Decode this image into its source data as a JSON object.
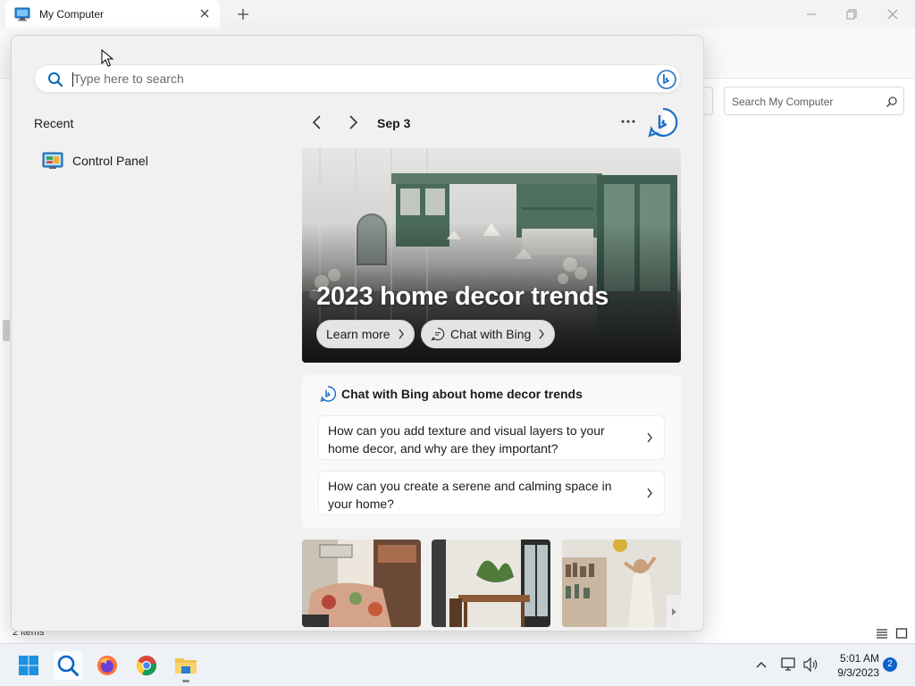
{
  "window": {
    "tab_title": "My Computer",
    "tab_icon": "monitor-icon",
    "search_placeholder": "Search My Computer",
    "status_items": "2 items"
  },
  "search": {
    "placeholder": "Type here to search",
    "value": "",
    "recent_title": "Recent",
    "recent_items": [
      {
        "label": "Control Panel",
        "icon": "control-panel-icon"
      }
    ],
    "date_label": "Sep 3"
  },
  "hero": {
    "title": "2023 home decor trends",
    "learn_more": "Learn more",
    "chat_with_bing": "Chat with Bing"
  },
  "chat_card": {
    "title": "Chat with Bing about home decor trends",
    "questions": [
      {
        "text": "How can you add texture and visual layers to your home decor, and why are they important?"
      },
      {
        "text": "How can you create a serene and calming space in your home?"
      }
    ]
  },
  "taskbar": {
    "apps": [
      "start-icon",
      "search-icon",
      "firefox-icon",
      "chrome-icon",
      "file-explorer-icon"
    ],
    "time": "5:01 AM",
    "date": "9/3/2023",
    "notification_count": "2"
  },
  "colors": {
    "accent": "#0a63c9",
    "panel_bg": "#f1f1f1",
    "taskbar_bg": "#eef1f6"
  }
}
